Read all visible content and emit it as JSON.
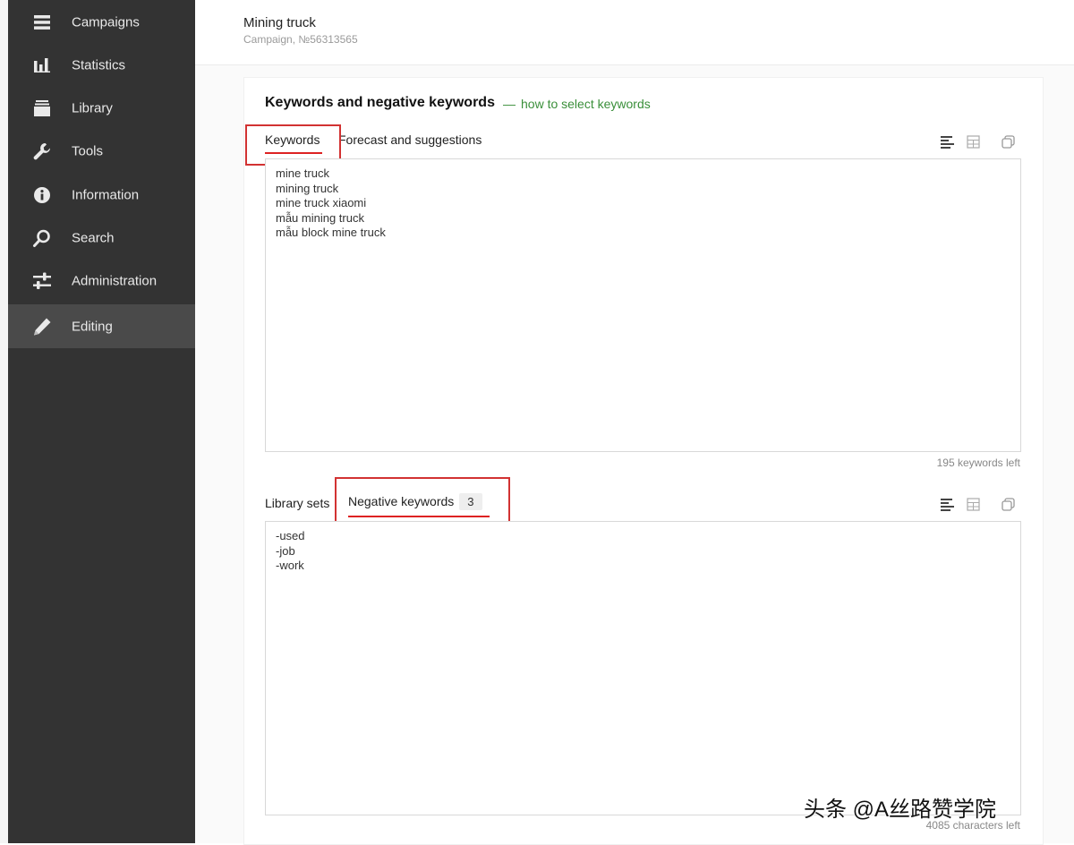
{
  "sidebar": {
    "items": [
      {
        "label": "Campaigns",
        "icon": "menu-icon"
      },
      {
        "label": "Statistics",
        "icon": "bar-chart-icon"
      },
      {
        "label": "Library",
        "icon": "library-icon"
      },
      {
        "label": "Tools",
        "icon": "wrench-icon"
      },
      {
        "label": "Information",
        "icon": "info-icon"
      },
      {
        "label": "Search",
        "icon": "search-icon"
      },
      {
        "label": "Administration",
        "icon": "sliders-icon"
      },
      {
        "label": "Editing",
        "icon": "pencil-icon",
        "active": true
      }
    ]
  },
  "header": {
    "campaign_name": "Mining truck",
    "campaign_id": "Campaign, №56313565"
  },
  "keywords_section": {
    "title": "Keywords and negative keywords",
    "link": "how to select keywords",
    "tabs": {
      "keywords": "Keywords",
      "forecast": "Forecast and suggestions"
    },
    "keywords": [
      "mine truck",
      "mining truck",
      "mine truck xiaomi",
      "mẫu mining truck",
      "mẫu block mine truck"
    ],
    "counter": "195 keywords left"
  },
  "negative_section": {
    "tabs": {
      "library_sets": "Library sets",
      "negative_keywords": "Negative keywords",
      "negative_count": "3"
    },
    "keywords": [
      "-used",
      "-job",
      "-work"
    ],
    "counter": "4085 characters left"
  },
  "watermark": "头条 @A丝路赞学院",
  "colors": {
    "sidebar_bg": "#333333",
    "sidebar_active": "#4a4a4a",
    "accent_link": "#3a8f3a",
    "highlight_red": "#d23232"
  }
}
